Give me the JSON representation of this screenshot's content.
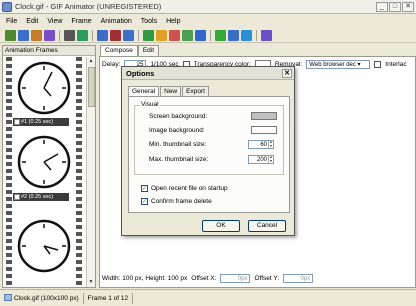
{
  "window": {
    "title": "Clock.gif - GIF Animator (UNREGISTERED)"
  },
  "menu": [
    "File",
    "Edit",
    "View",
    "Frame",
    "Animation",
    "Tools",
    "Help"
  ],
  "colors": {
    "toolbar_icons": [
      "#4c8a2c",
      "#3b6ec9",
      "#c97a2b",
      "#7a4ec9",
      "#555555",
      "#2a9c5b",
      "#3b6ec9",
      "#a03030",
      "#3b6ec9",
      "#2f9a40",
      "#e0a020",
      "#d05050",
      "#4ea04e",
      "#3366cc",
      "#33aa33",
      "#3b6ec9",
      "#2a8fd6",
      "#6b4ec9"
    ]
  },
  "left_panel": {
    "header": "Animation Frames",
    "frames": [
      {
        "caption": "#1 (0.25 sec)"
      },
      {
        "caption": "#2 (0.25 sec)"
      },
      {
        "caption": ""
      }
    ]
  },
  "tabs": {
    "compose": "Compose",
    "edit": "Edit"
  },
  "props": {
    "delay_label": "Delay:",
    "delay_value": "25",
    "delay_unit": "1/100 sec",
    "transparency_label": "Transparency color:",
    "removal_label": "Removal:",
    "removal_value": "Web browser dec",
    "interlace_label": "Interlac"
  },
  "status_row": {
    "size": "Width: 100 px, Height: 100 px",
    "offset_x_label": "Offset X:",
    "offset_x_value": "0px",
    "offset_y_label": "Offset Y:",
    "offset_y_value": "0px"
  },
  "statusbar": {
    "file": "Clock.gif (100x100 px)",
    "frame": "Frame 1 of 12"
  },
  "dialog": {
    "title": "Options",
    "tabs": [
      "General",
      "New",
      "Export"
    ],
    "group_title": "Visual",
    "screen_bg_label": "Screen background:",
    "image_bg_label": "Image background:",
    "min_thumb_label": "Min. thumbnail size:",
    "min_thumb_value": "60",
    "max_thumb_label": "Max. thumbnail size:",
    "max_thumb_value": "200",
    "open_recent_label": "Open recent file on startup",
    "confirm_delete_label": "Confirm frame delete",
    "ok_label": "OK",
    "cancel_label": "Cancel",
    "screen_bg_color": "#c0c0c0",
    "image_bg_color": "#ffffff"
  }
}
